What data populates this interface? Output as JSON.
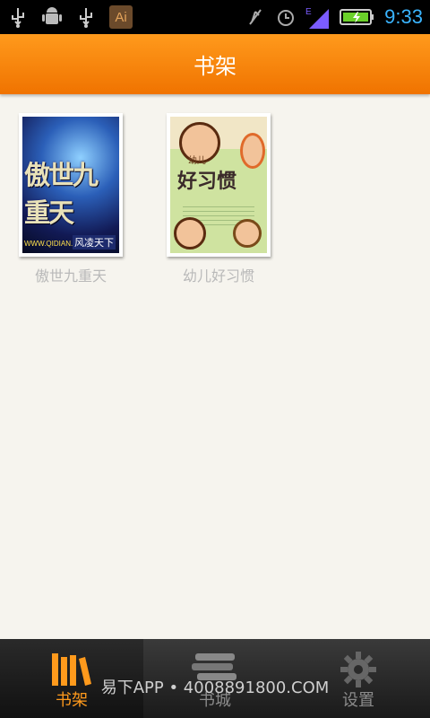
{
  "status_bar": {
    "icons_left": [
      "usb-icon",
      "android-debug-icon",
      "usb-icon",
      "ai-app-icon"
    ],
    "ai_label": "Ai",
    "icons_right": [
      "vibrate-off-icon",
      "alarm-icon",
      "signal-icon",
      "battery-icon"
    ],
    "network": "E",
    "time": "9:33"
  },
  "header": {
    "title": "书架"
  },
  "shelf": {
    "books": [
      {
        "title": "傲世九重天",
        "cover_text": "傲世九重天",
        "cover_brand": "WWW.QIDIAN.COM",
        "cover_author": "风凌天下"
      },
      {
        "title": "幼儿好习惯",
        "cover_small": "幼儿",
        "cover_text": "好习惯"
      }
    ]
  },
  "tabs": [
    {
      "label": "书架",
      "icon": "bookshelf-icon",
      "active": true
    },
    {
      "label": "书城",
      "icon": "books-stack-icon",
      "active": false
    },
    {
      "label": "设置",
      "icon": "gear-icon",
      "active": false
    }
  ],
  "footer_overlay": "易下APP • 4008891800.COM",
  "colors": {
    "accent": "#f07300",
    "tab_active": "#ff9a1c",
    "clock": "#3ab4ff"
  }
}
